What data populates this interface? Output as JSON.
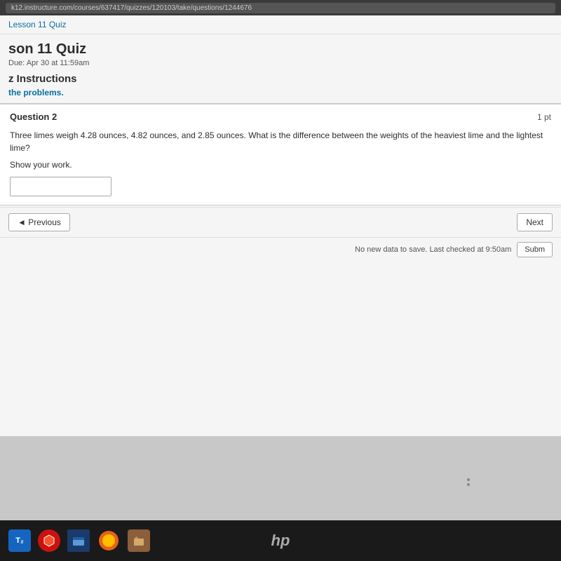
{
  "browser": {
    "url": "k12.instructure.com/courses/637417/quizzes/120103/take/questions/1244676"
  },
  "breadcrumb": {
    "text": "Lesson 11 Quiz"
  },
  "quiz": {
    "title": "son 11 Quiz",
    "due": "Apr 30 at 11:59am"
  },
  "instructions": {
    "title": "z Instructions",
    "text": "the problems."
  },
  "question": {
    "label": "Question 2",
    "points": "1 pt",
    "text": "Three limes weigh 4.28 ounces, 4.82 ounces, and 2.85 ounces. What is the difference between the weights of the heaviest lime and the lightest lime?",
    "show_work": "Show your work.",
    "answer_placeholder": ""
  },
  "navigation": {
    "previous_label": "◄ Previous",
    "next_label": "Next"
  },
  "status": {
    "message": "No new data to save. Last checked at 9:50am",
    "submit_label": "Subm"
  },
  "taskbar": {
    "icons": [
      {
        "name": "T2-icon",
        "label": "T₂"
      },
      {
        "name": "brave-icon",
        "label": "🔴"
      },
      {
        "name": "browser-icon",
        "label": "🟦"
      },
      {
        "name": "firefox-icon",
        "label": "🦊"
      },
      {
        "name": "files-icon",
        "label": "📦"
      }
    ],
    "hp_label": "hp"
  }
}
